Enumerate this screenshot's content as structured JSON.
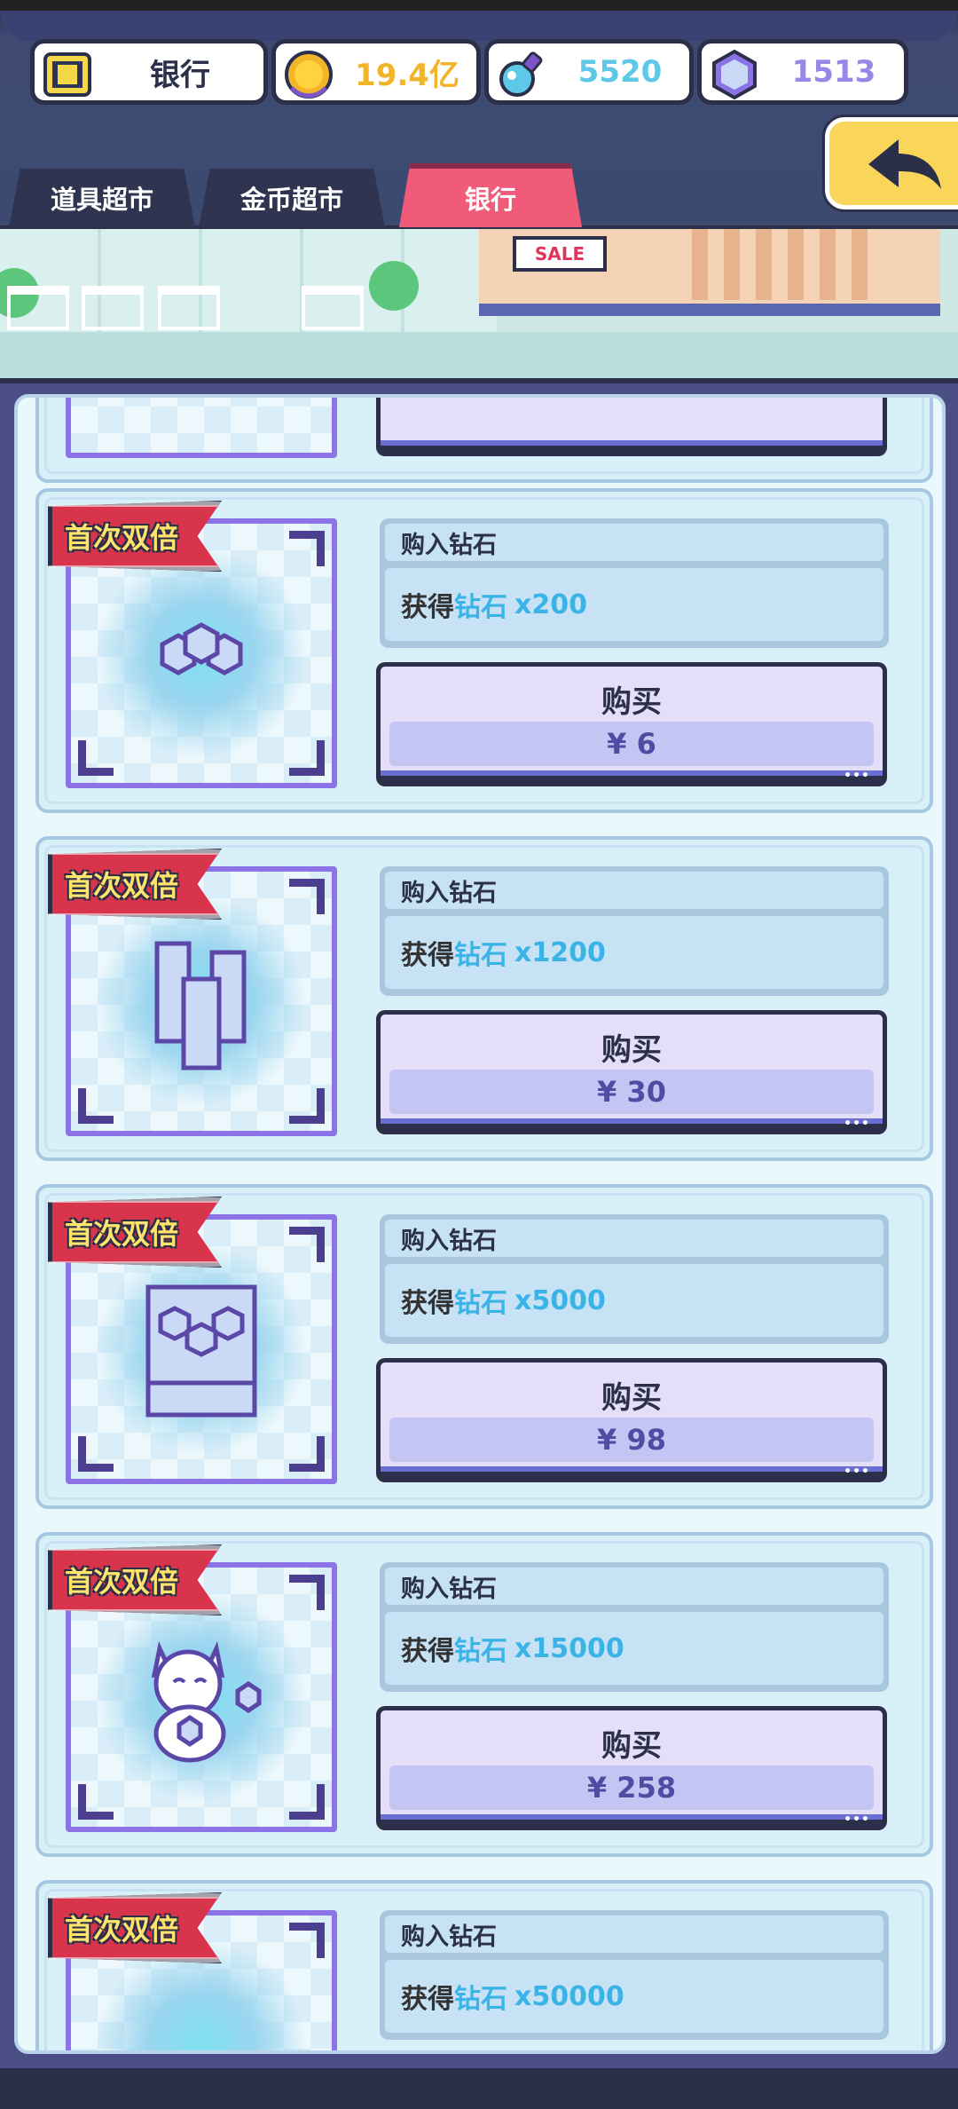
{
  "resources": {
    "bank_label": "银行",
    "gold": "19.4亿",
    "potion": "5520",
    "gems": "1513",
    "colors": {
      "gold": "#f2b52a",
      "potion": "#5ec8e8",
      "gems": "#9a86e6"
    }
  },
  "tabs": [
    {
      "label": "道具超市",
      "active": false
    },
    {
      "label": "金币超市",
      "active": false
    },
    {
      "label": "银行",
      "active": true
    }
  ],
  "banner": {
    "sale_sign": "SALE"
  },
  "card_common": {
    "title": "购入钻石",
    "gain_prefix": "获得",
    "gain_item": "钻石",
    "buy_label": "购买",
    "ribbon": "首次双倍"
  },
  "cards": [
    {
      "amount": "x200",
      "price": "¥ 6"
    },
    {
      "amount": "x1200",
      "price": "¥ 30"
    },
    {
      "amount": "x5000",
      "price": "¥ 98"
    },
    {
      "amount": "x15000",
      "price": "¥ 258"
    },
    {
      "amount": "x50000",
      "price": ""
    }
  ],
  "icons": [
    "bank-card-icon",
    "gold-coin-icon",
    "potion-icon",
    "gem-icon",
    "back-arrow-icon"
  ]
}
